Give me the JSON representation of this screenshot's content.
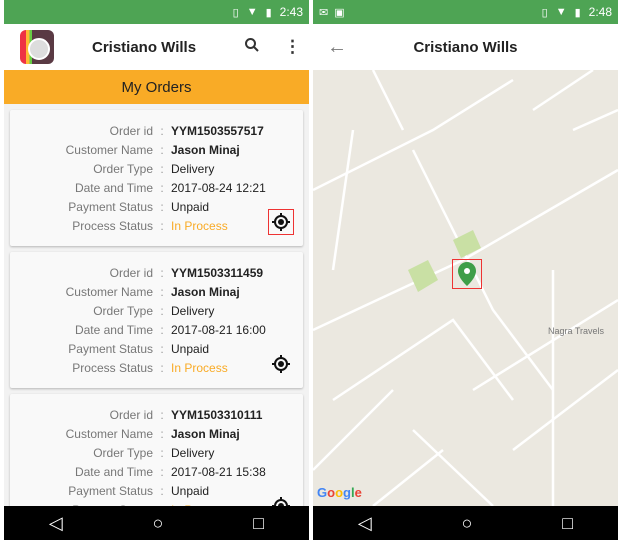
{
  "left": {
    "status": {
      "time": "2:43"
    },
    "appbar": {
      "title": "Cristiano Wills",
      "search_icon": "search-icon",
      "menu_icon": "more-vert-icon"
    },
    "section_title": "My Orders",
    "labels": {
      "order_id": "Order id",
      "customer": "Customer Name",
      "type": "Order Type",
      "datetime": "Date and Time",
      "payment": "Payment Status",
      "process": "Process Status",
      "sep": ":"
    },
    "orders": [
      {
        "order_id": "YYM1503557517",
        "customer": "Jason Minaj",
        "type": "Delivery",
        "datetime": "2017-08-24 12:21",
        "payment": "Unpaid",
        "process": "In Process"
      },
      {
        "order_id": "YYM1503311459",
        "customer": "Jason Minaj",
        "type": "Delivery",
        "datetime": "2017-08-21 16:00",
        "payment": "Unpaid",
        "process": "In Process"
      },
      {
        "order_id": "YYM1503310111",
        "customer": "Jason Minaj",
        "type": "Delivery",
        "datetime": "2017-08-21 15:38",
        "payment": "Unpaid",
        "process": "In Process"
      }
    ]
  },
  "right": {
    "status": {
      "time": "2:48"
    },
    "appbar": {
      "title": "Cristiano Wills"
    },
    "map": {
      "place_label": "Nagra Travels",
      "attribution": "Google"
    }
  },
  "colors": {
    "status_bar": "#4ea454",
    "accent": "#f9ab26",
    "pin": "#3f9e48"
  }
}
